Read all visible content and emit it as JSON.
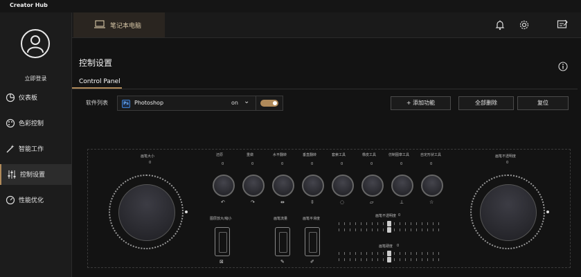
{
  "app": {
    "title": "Creator Hub"
  },
  "sidebar": {
    "login_label": "立即登录",
    "items": [
      {
        "label": "仪表板",
        "icon": "dashboard-icon"
      },
      {
        "label": "色彩控制",
        "icon": "palette-icon"
      },
      {
        "label": "智能工作",
        "icon": "magic-wand-icon"
      },
      {
        "label": "控制设置",
        "icon": "sliders-icon",
        "active": true
      },
      {
        "label": "性能优化",
        "icon": "speedometer-icon"
      }
    ]
  },
  "header": {
    "tab_label": "笔记本电脑",
    "icons": [
      "bell-icon",
      "gear-icon",
      "feedback-icon"
    ]
  },
  "page": {
    "title": "控制设置",
    "subtab": "Control Panel",
    "software_list_label": "软件列表",
    "selected_app": {
      "badge": "Ps",
      "name": "Photoshop",
      "state": "on"
    },
    "toggle_on": true,
    "buttons": {
      "add": "+ 添加功能",
      "delete_all": "全部删除",
      "reset": "复位"
    }
  },
  "controls": {
    "left_dial": {
      "label": "画笔大小",
      "value": "0"
    },
    "right_dial": {
      "label": "画笔不透明度",
      "value": "0"
    },
    "small_knobs": [
      {
        "label": "还原",
        "icon": "undo-icon",
        "value": "0"
      },
      {
        "label": "重做",
        "icon": "redo-icon",
        "value": "0"
      },
      {
        "label": "水平翻转",
        "icon": "flip-horizontal-icon",
        "value": "0"
      },
      {
        "label": "垂直翻转",
        "icon": "flip-vertical-icon",
        "value": "0"
      },
      {
        "label": "套索工具",
        "icon": "lasso-icon",
        "value": "0"
      },
      {
        "label": "橡皮工具",
        "icon": "eraser-icon",
        "value": "0"
      },
      {
        "label": "仿制图章工具",
        "icon": "stamp-icon",
        "value": "0"
      },
      {
        "label": "自定形状工具",
        "icon": "shape-icon",
        "value": "0"
      }
    ],
    "vertical_sliders": [
      {
        "label": "图层放大/缩小",
        "icon": "zoom-icon"
      },
      {
        "label": "画笔流量",
        "icon": "brush-flow-icon"
      },
      {
        "label": "画笔平滑度",
        "icon": "brush-smooth-icon"
      }
    ],
    "horizontal_sliders": [
      {
        "label": "画笔不透明度",
        "value": "0"
      },
      {
        "label": "画笔硬度",
        "value": "0"
      }
    ]
  },
  "colors": {
    "accent": "#b08a5a",
    "background": "#121212",
    "sidebar": "#1c1c1c"
  }
}
